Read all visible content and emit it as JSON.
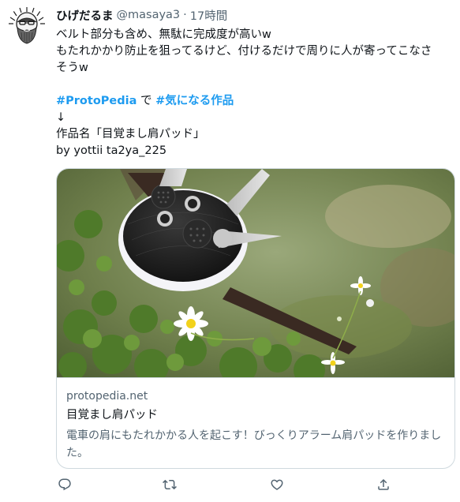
{
  "tweet": {
    "display_name": "ひげだるま",
    "handle": "@masaya3",
    "separator": "·",
    "time": "17時間",
    "text_lines": [
      "ベルト部分も含め、無駄に完成度が高いw",
      "もたれかかり防止を狙ってるけど、付けるだけで周りに人が寄ってこなさ",
      "そうw"
    ],
    "hashtag_line": {
      "tag1": "#ProtoPedia",
      "middle": " で ",
      "tag2": "#気になる作品"
    },
    "arrow": "↓",
    "work_name": "作品名「目覚まし肩パッド」",
    "by_line": "by yottii ta2ya_225"
  },
  "card": {
    "domain": "protopedia.net",
    "title": "目覚まし肩パッド",
    "description": "電車の肩にもたれかかる人を起こす！びっくりアラーム肩パッドを作りました。"
  },
  "icons": {
    "avatar": "bearded-man-illustration",
    "reply": "reply-icon",
    "retweet": "retweet-icon",
    "like": "like-icon",
    "share": "share-icon"
  },
  "colors": {
    "text": "#0f1419",
    "secondary": "#536471",
    "link": "#1d9bf0",
    "border": "#cfd9de"
  }
}
